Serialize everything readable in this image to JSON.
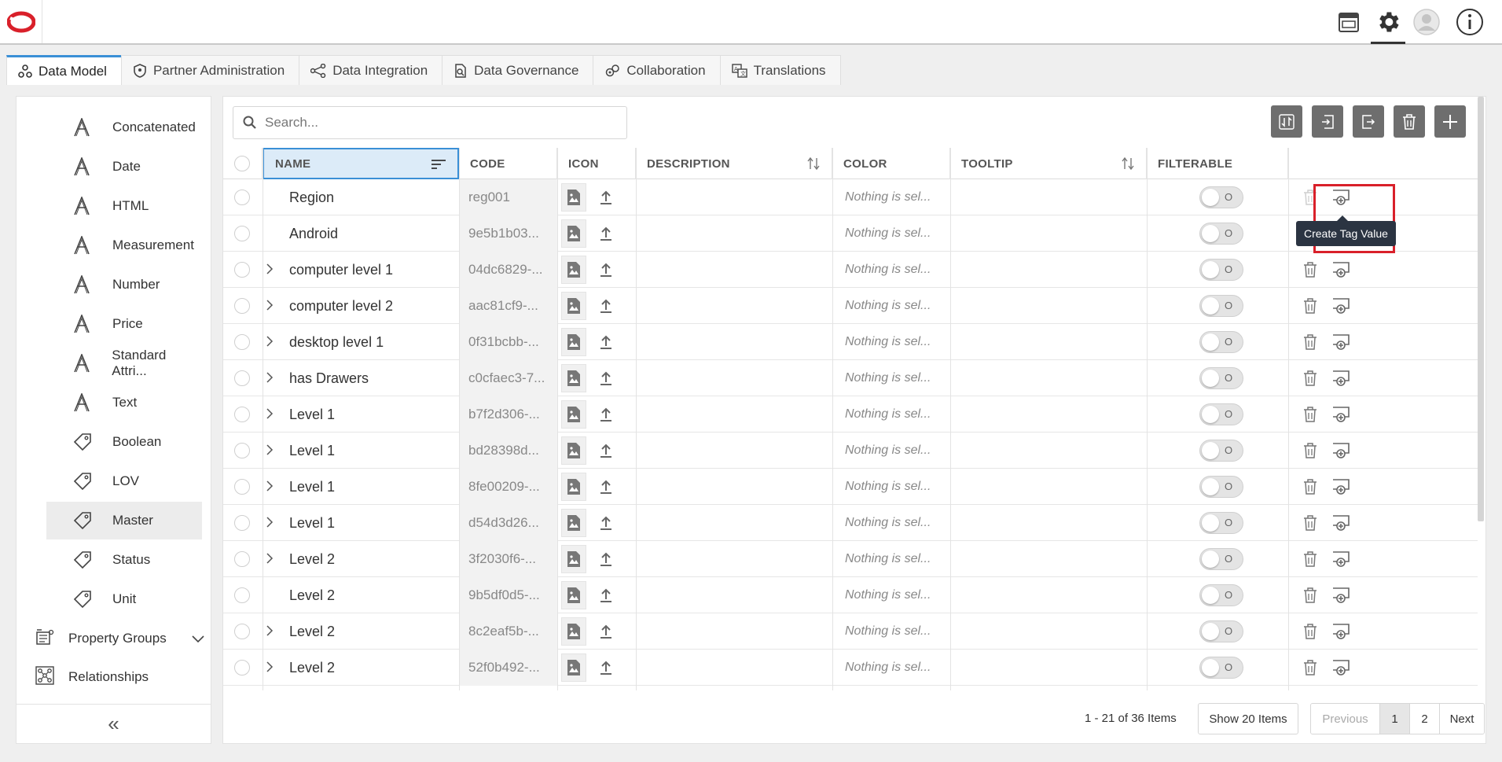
{
  "tabs": [
    {
      "label": "Data Model",
      "icon": "data-model-icon",
      "active": true
    },
    {
      "label": "Partner Administration",
      "icon": "shield-icon",
      "active": false
    },
    {
      "label": "Data Integration",
      "icon": "integration-icon",
      "active": false
    },
    {
      "label": "Data Governance",
      "icon": "governance-icon",
      "active": false
    },
    {
      "label": "Collaboration",
      "icon": "collaboration-icon",
      "active": false
    },
    {
      "label": "Translations",
      "icon": "translations-icon",
      "active": false
    }
  ],
  "sidebar": {
    "items": [
      {
        "label": "Concatenated",
        "icon": "attribute-icon"
      },
      {
        "label": "Date",
        "icon": "attribute-icon"
      },
      {
        "label": "HTML",
        "icon": "attribute-icon"
      },
      {
        "label": "Measurement",
        "icon": "attribute-icon"
      },
      {
        "label": "Number",
        "icon": "attribute-icon"
      },
      {
        "label": "Price",
        "icon": "attribute-icon"
      },
      {
        "label": "Standard Attri...",
        "icon": "attribute-icon"
      },
      {
        "label": "Text",
        "icon": "attribute-icon"
      },
      {
        "label": "Boolean",
        "icon": "tag-icon"
      },
      {
        "label": "LOV",
        "icon": "tag-icon"
      },
      {
        "label": "Master",
        "icon": "tag-icon"
      },
      {
        "label": "Status",
        "icon": "tag-icon"
      },
      {
        "label": "Unit",
        "icon": "tag-icon"
      }
    ],
    "selected_item": "Master",
    "groups": [
      {
        "label": "Property Groups",
        "icon": "property-groups-icon"
      },
      {
        "label": "Relationships",
        "icon": "relationships-icon"
      }
    ],
    "collapse_glyph": "«"
  },
  "search": {
    "placeholder": "Search..."
  },
  "table": {
    "columns": {
      "name": "NAME",
      "code": "CODE",
      "icon": "ICON",
      "description": "DESCRIPTION",
      "color": "COLOR",
      "tooltip": "TOOLTIP",
      "filterable": "FILTERABLE"
    },
    "color_placeholder": "Nothing is sel...",
    "toggle_text": "O",
    "rows": [
      {
        "name": "Region",
        "code": "reg001",
        "expandable": false
      },
      {
        "name": "Android",
        "code": "9e5b1b03...",
        "expandable": false
      },
      {
        "name": "computer level 1",
        "code": "04dc6829-...",
        "expandable": true
      },
      {
        "name": "computer level 2",
        "code": "aac81cf9-...",
        "expandable": true
      },
      {
        "name": "desktop level 1",
        "code": "0f31bcbb-...",
        "expandable": true
      },
      {
        "name": "has Drawers",
        "code": "c0cfaec3-7...",
        "expandable": true
      },
      {
        "name": "Level 1",
        "code": "b7f2d306-...",
        "expandable": true
      },
      {
        "name": "Level 1",
        "code": "bd28398d...",
        "expandable": true
      },
      {
        "name": "Level 1",
        "code": "8fe00209-...",
        "expandable": true
      },
      {
        "name": "Level 1",
        "code": "d54d3d26...",
        "expandable": true
      },
      {
        "name": "Level 2",
        "code": "3f2030f6-...",
        "expandable": true
      },
      {
        "name": "Level 2",
        "code": "9b5df0d5-...",
        "expandable": false
      },
      {
        "name": "Level 2",
        "code": "8c2eaf5b-...",
        "expandable": true
      },
      {
        "name": "Level 2",
        "code": "52f0b492-...",
        "expandable": true
      }
    ]
  },
  "tooltip": {
    "text": "Create Tag Value"
  },
  "footer": {
    "items_info": "1 - 21 of 36 Items",
    "show_label": "Show 20 Items",
    "prev": "Previous",
    "pages": [
      "1",
      "2"
    ],
    "current_page": "1",
    "next": "Next"
  },
  "colors": {
    "accent": "#3a8fd6",
    "highlight": "#d9202a",
    "logo": "#d9202a",
    "toolbar_button": "#6e6e6e"
  }
}
